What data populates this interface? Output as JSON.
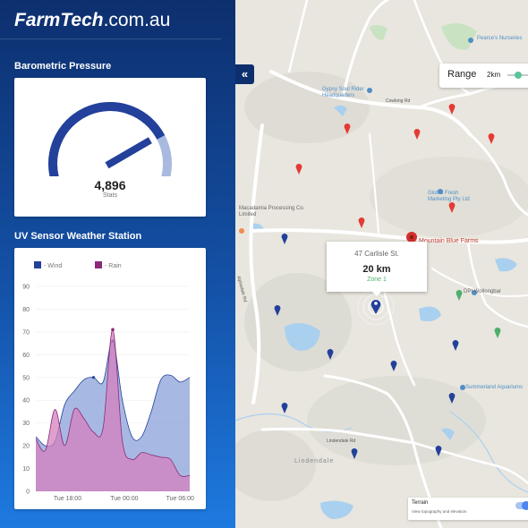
{
  "brand": {
    "bold": "FarmTech",
    "rest": ".com.au"
  },
  "barometer": {
    "title": "Barometric Pressure",
    "value": "4,896",
    "label": "Stats",
    "level": 0.78,
    "colors": {
      "track": "#a9b9e0",
      "fill": "#23409a",
      "needle": "#23409a"
    }
  },
  "weather": {
    "title": "UV Sensor Weather Station"
  },
  "chart_data": {
    "type": "area",
    "legend": [
      "- Wind",
      "- Rain"
    ],
    "series": [
      {
        "name": "- Wind",
        "color": "#8aa2d8",
        "stroke": "#23409a",
        "x": [
          0,
          1,
          2,
          3,
          4,
          5,
          6,
          7,
          8,
          9,
          10,
          11,
          12,
          13,
          14,
          15,
          16
        ],
        "values": [
          24,
          20,
          22,
          38,
          44,
          49,
          50,
          48,
          66,
          40,
          24,
          24,
          35,
          49,
          51,
          48,
          50
        ]
      },
      {
        "name": "- Rain",
        "color": "#d480be",
        "stroke": "#8a2a78",
        "x": [
          0,
          1,
          2,
          3,
          4,
          5,
          6,
          7,
          8,
          9,
          10,
          11,
          12,
          13,
          14,
          15,
          16
        ],
        "values": [
          23,
          18,
          36,
          20,
          36,
          32,
          26,
          28,
          71,
          22,
          14,
          17,
          16,
          15,
          14,
          7,
          7
        ]
      }
    ],
    "yticks": [
      0,
      10,
      20,
      30,
      40,
      50,
      60,
      70,
      80,
      90
    ],
    "ylim": [
      0,
      90
    ],
    "xticks": [
      {
        "label": "Tue 18:00",
        "x": 3.3
      },
      {
        "label": "Tue 00:00",
        "x": 9.2
      },
      {
        "label": "Tue 06:00",
        "x": 15.0
      }
    ],
    "xlim": [
      0,
      16
    ]
  },
  "map": {
    "range": {
      "label": "Range",
      "value": "2km"
    },
    "popup": {
      "address": "47 Carlisle St.",
      "distance": "20 km",
      "zone": "Zone 1"
    },
    "terrain": {
      "title": "Terrain",
      "subtitle": "View topography and elevation",
      "enabled": true
    },
    "labels": {
      "nurseries": "Pearce's Nurseries",
      "gypsy": "Gypsy Soul Rider Headquarters",
      "global": "Global Fresh Marketing Pty Ltd",
      "macadamia": "Macadamia Processing Co. Limited",
      "mountain": "Mountain Blue Farms",
      "dpi": "DPI Wollongbar",
      "summerland": "Summerland Aquariums",
      "lindendale": "Lindendale",
      "cowlong": "Cowlong Rd",
      "lindendale_rd": "Lindendale Rd",
      "alphadale": "Alphadale Rd"
    }
  },
  "collapse": {
    "icon": "«"
  }
}
